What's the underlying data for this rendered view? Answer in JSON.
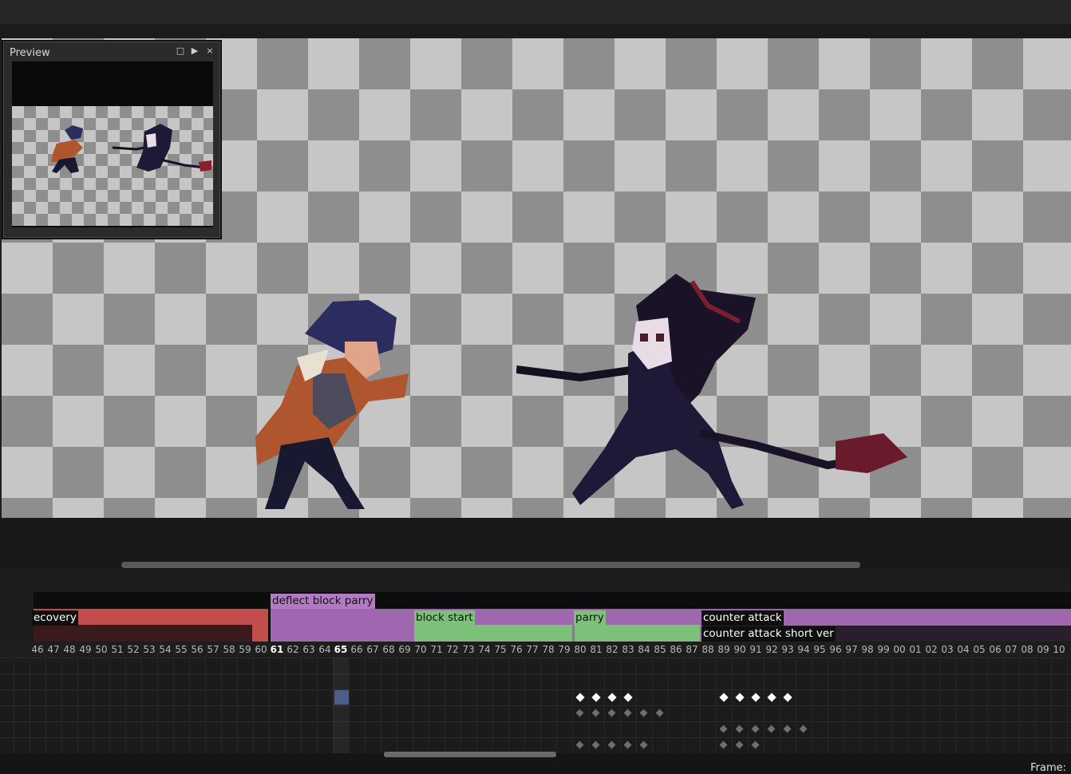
{
  "preview": {
    "title": "Preview",
    "btn_maximize": "□",
    "btn_play": "▶",
    "btn_close": "×"
  },
  "timeline": {
    "tags": [
      {
        "label": "ecovery",
        "color": "#c24d4d"
      },
      {
        "label": "deflect block parry",
        "color": "#a066b0"
      },
      {
        "label": "block start",
        "color": "#7cc07a"
      },
      {
        "label": "parry",
        "color": "#7cc07a"
      },
      {
        "label": "counter attack",
        "color": "#a066b0"
      },
      {
        "label": "counter attack short ver",
        "color": "#2a1d2e"
      }
    ],
    "frame_numbers": [
      "46",
      "47",
      "48",
      "49",
      "50",
      "51",
      "52",
      "53",
      "54",
      "55",
      "56",
      "57",
      "58",
      "59",
      "60",
      "61",
      "62",
      "63",
      "64",
      "65",
      "66",
      "67",
      "68",
      "69",
      "70",
      "71",
      "72",
      "73",
      "74",
      "75",
      "76",
      "77",
      "78",
      "79",
      "80",
      "81",
      "82",
      "83",
      "84",
      "85",
      "86",
      "87",
      "88",
      "89",
      "90",
      "91",
      "92",
      "93",
      "94",
      "95",
      "96",
      "97",
      "98",
      "99",
      "00",
      "01",
      "02",
      "03",
      "04",
      "05",
      "06",
      "07",
      "08",
      "09",
      "10"
    ],
    "active_frames": [
      "61",
      "65"
    ]
  },
  "status": {
    "frame_label": "Frame:"
  },
  "colors": {
    "cel_highlight": "#4d5d8a",
    "keyframe": "#ffffff",
    "keyframe_dim": "#6e6e6e"
  }
}
